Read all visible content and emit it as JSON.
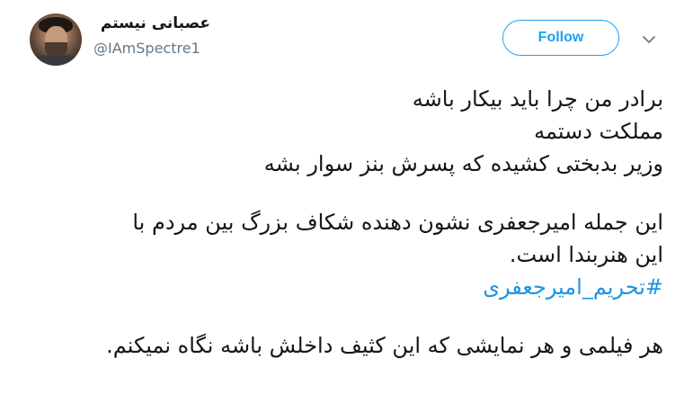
{
  "user": {
    "display_name": "عصبانی نیستم",
    "handle": "@IAmSpectre1",
    "avatar_icon": "profile-photo"
  },
  "follow_button": {
    "label": "Follow"
  },
  "menu": {
    "icon": "chevron-down-icon"
  },
  "tweet": {
    "line1": "برادر من چرا باید بیکار باشه",
    "line2": "مملکت دستمه",
    "line3": "وزیر بدبختی کشیده که پسرش بنز سوار بشه",
    "line4": "این جمله امیرجعفری نشون دهنده شکاف بزرگ بین مردم با",
    "line5": "این هنربندا است.",
    "hashtag": "#تحریم_امیرجعفری",
    "line6": "هر فیلمی و هر نمایشی که این کثیف داخلش باشه نگاه نمیکنم."
  },
  "colors": {
    "accent": "#1da1f2",
    "hashtag": "#1b95e0",
    "text": "#14171a",
    "secondary": "#657786"
  }
}
